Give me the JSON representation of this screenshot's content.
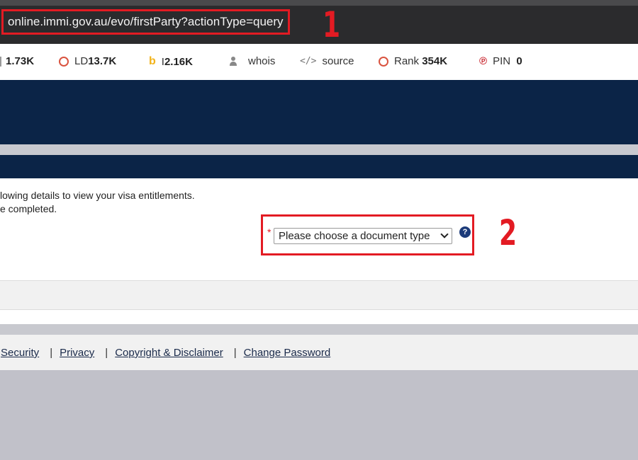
{
  "browser": {
    "url": "online.immi.gov.au/evo/firstParty?actionType=query",
    "callout_1": "1"
  },
  "seo_toolbar": {
    "items": [
      {
        "icon": "bar-icon",
        "label": "",
        "value": "1.73K"
      },
      {
        "icon": "circle-icon",
        "label": "LD",
        "value": "13.7K"
      },
      {
        "icon": "bing-icon",
        "label": "I",
        "value": "2.16K"
      },
      {
        "icon": "person-icon",
        "label": "whois",
        "value": ""
      },
      {
        "icon": "code-icon",
        "label": "source",
        "value": ""
      },
      {
        "icon": "circle-icon",
        "label": "Rank",
        "value": "354K"
      },
      {
        "icon": "pinterest-icon",
        "label": "PIN",
        "value": "0"
      }
    ]
  },
  "form": {
    "intro_line_1": "lowing details to view your visa entitlements.",
    "intro_line_2": "e completed.",
    "required_marker": "*",
    "document_type_select": "Please choose a document type",
    "help_icon_glyph": "?",
    "callout_2": "2"
  },
  "footer": {
    "links": [
      "Security",
      "Privacy",
      "Copyright & Disclaimer",
      "Change Password"
    ],
    "separator": "|"
  },
  "colors": {
    "banner": "#0b2447",
    "annotation_red": "#e31b23",
    "address_bar": "#2b2b2d"
  }
}
